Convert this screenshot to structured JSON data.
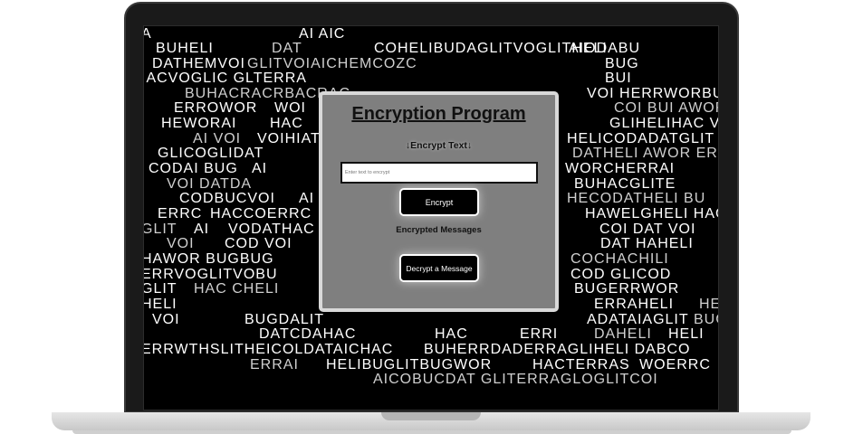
{
  "app": {
    "title": "Encryption Program",
    "encrypt_heading": "↓Encrypt Text↓",
    "input_placeholder": "Enter text to encrypt",
    "input_value": "",
    "encrypt_button": "Encrypt",
    "messages_heading": "Encrypted Messages",
    "decrypt_button": "Decrypt a Message"
  },
  "background_text": {
    "words": [
      "A",
      "AI AIC",
      "BUHELI",
      "DAT",
      "COHELIBUDAGLITVOGLITHELI",
      "AIODABU",
      "DATHEMVOI",
      "GLITVOIAICHEMCOZC",
      "BUG",
      "IACVOGLIC GLTERRA",
      "BUI",
      "BUHACRACRBACRAC",
      "VOI HERRWORBUG",
      "ERROWOR",
      "WOI",
      "COI BUI AWOR",
      "HEWORAI",
      "HAC",
      "GLIHELIHAC VOI",
      "AI VOI",
      "VOIHIAT",
      "HELICODADATGLIT GLI",
      "GLICOGLIDAT",
      "DATHELI AWOR ERI",
      "CODAI BUG",
      "AI",
      "WORCHERRAI",
      "VOI DATDA",
      "BUHACGLITE",
      "CODBUCVOI",
      "AI",
      "HECODATHELI BU",
      "ERRC",
      "HACCOERRC",
      "HAWELGHELI HAC",
      "GLIT",
      "AI",
      "VODATHAC",
      "COI DAT VOI",
      "VOI",
      "COD VOI",
      "DAT HAHELI",
      "HAWOR BUGBUG",
      "COCHACHILI",
      "ERRVOGLITVOBU",
      "COD GLICOD",
      "GLIT",
      "HAC CHELI",
      "BUGERRWOR",
      "HELI",
      "ERRAHELI",
      "HE",
      "VOI",
      "BUGDALIT",
      "ADATAIAGLIT",
      "BUG",
      "DATCDAHAC",
      "HAC",
      "ERRI",
      "DAHELI",
      "HELI",
      "ERRWTHSLITHEICOLDATAICHAC",
      "BUHERRDADERRAGLIHELI DABCO",
      "ERRAI",
      "HELIBUGLITBUGWOR",
      "HACTERRAS",
      "WOERRC",
      "AICOBUCDAT GLITERRAGLOGLITCOI"
    ]
  },
  "colors": {
    "screen_bg": "#000000",
    "panel_bg": "#7f7f7f",
    "panel_border": "#d9d9d9",
    "button_bg": "#000000",
    "button_text": "#ffffff",
    "rain_text": "#ffffff"
  }
}
